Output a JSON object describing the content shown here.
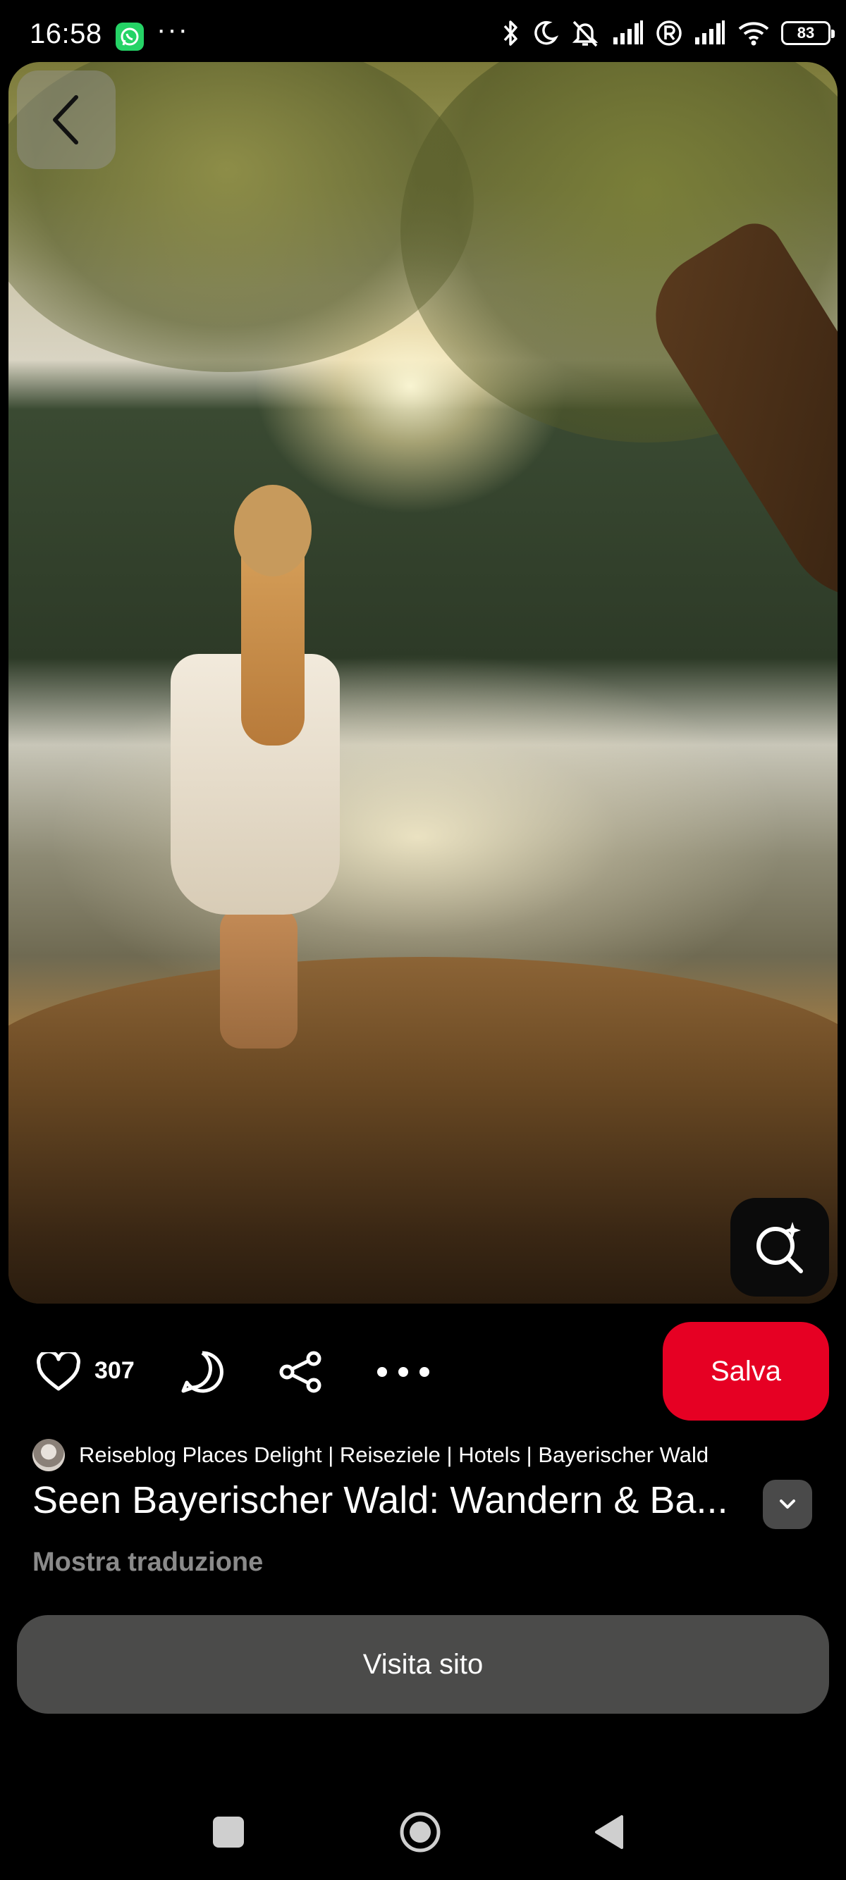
{
  "status_bar": {
    "time": "16:58",
    "dots": "···",
    "battery": "83",
    "icons": [
      "whatsapp-icon",
      "bluetooth-icon",
      "moon-icon",
      "alarm-off-icon",
      "signal-icon",
      "registered-icon",
      "signal-icon",
      "wifi-icon",
      "battery-icon"
    ]
  },
  "pin": {
    "like_count": "307",
    "save_label": "Salva",
    "creator": "Reiseblog Places Delight | Reiseziele | Hotels | Bayerischer Wald",
    "title": "Seen Bayerischer Wald: Wandern & Ba...",
    "translate_label": "Mostra traduzione",
    "visit_label": "Visita sito"
  },
  "colors": {
    "save_button": "#e60023",
    "visit_button": "#4b4b4a",
    "background": "#000000"
  }
}
